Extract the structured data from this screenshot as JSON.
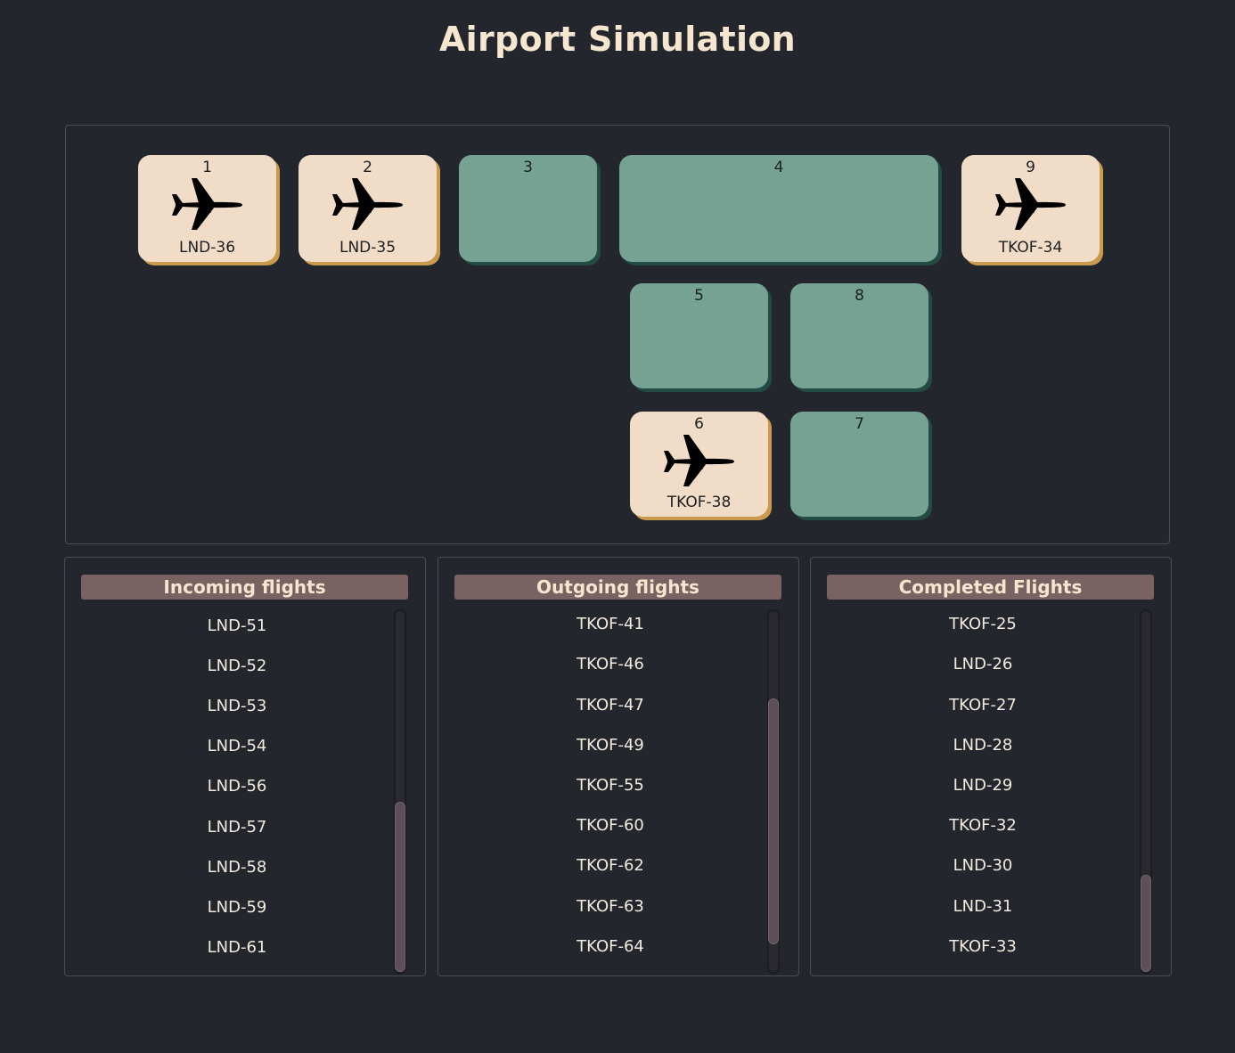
{
  "title": "Airport Simulation",
  "stations": [
    {
      "number": "1",
      "flight": "LND-36",
      "occupied": true
    },
    {
      "number": "2",
      "flight": "LND-35",
      "occupied": true
    },
    {
      "number": "3",
      "flight": "",
      "occupied": false
    },
    {
      "number": "4",
      "flight": "",
      "occupied": false
    },
    {
      "number": "9",
      "flight": "TKOF-34",
      "occupied": true
    },
    {
      "number": "5",
      "flight": "",
      "occupied": false
    },
    {
      "number": "8",
      "flight": "",
      "occupied": false
    },
    {
      "number": "6",
      "flight": "TKOF-38",
      "occupied": true
    },
    {
      "number": "7",
      "flight": "",
      "occupied": false
    }
  ],
  "panels": {
    "incoming": {
      "title": "Incoming flights",
      "items": [
        "LND-51",
        "LND-52",
        "LND-53",
        "LND-54",
        "LND-56",
        "LND-57",
        "LND-58",
        "LND-59",
        "LND-61"
      ],
      "scroll_position": 1.0
    },
    "outgoing": {
      "title": "Outgoing flights",
      "items": [
        "TKOF-41",
        "TKOF-46",
        "TKOF-47",
        "TKOF-49",
        "TKOF-55",
        "TKOF-60",
        "TKOF-62",
        "TKOF-63",
        "TKOF-64"
      ],
      "scroll_position": 0.7
    },
    "completed": {
      "title": "Completed Flights",
      "items": [
        "TKOF-25",
        "LND-26",
        "TKOF-27",
        "LND-28",
        "LND-29",
        "TKOF-32",
        "LND-30",
        "LND-31",
        "TKOF-33"
      ],
      "scroll_position": 1.0
    }
  },
  "colors": {
    "background": "#23262c",
    "station_free": "#76a294",
    "station_occupied": "#f1dcc7",
    "header": "#7b6262",
    "title": "#f6e6cf"
  },
  "icons": {
    "plane": "airplane-icon"
  }
}
